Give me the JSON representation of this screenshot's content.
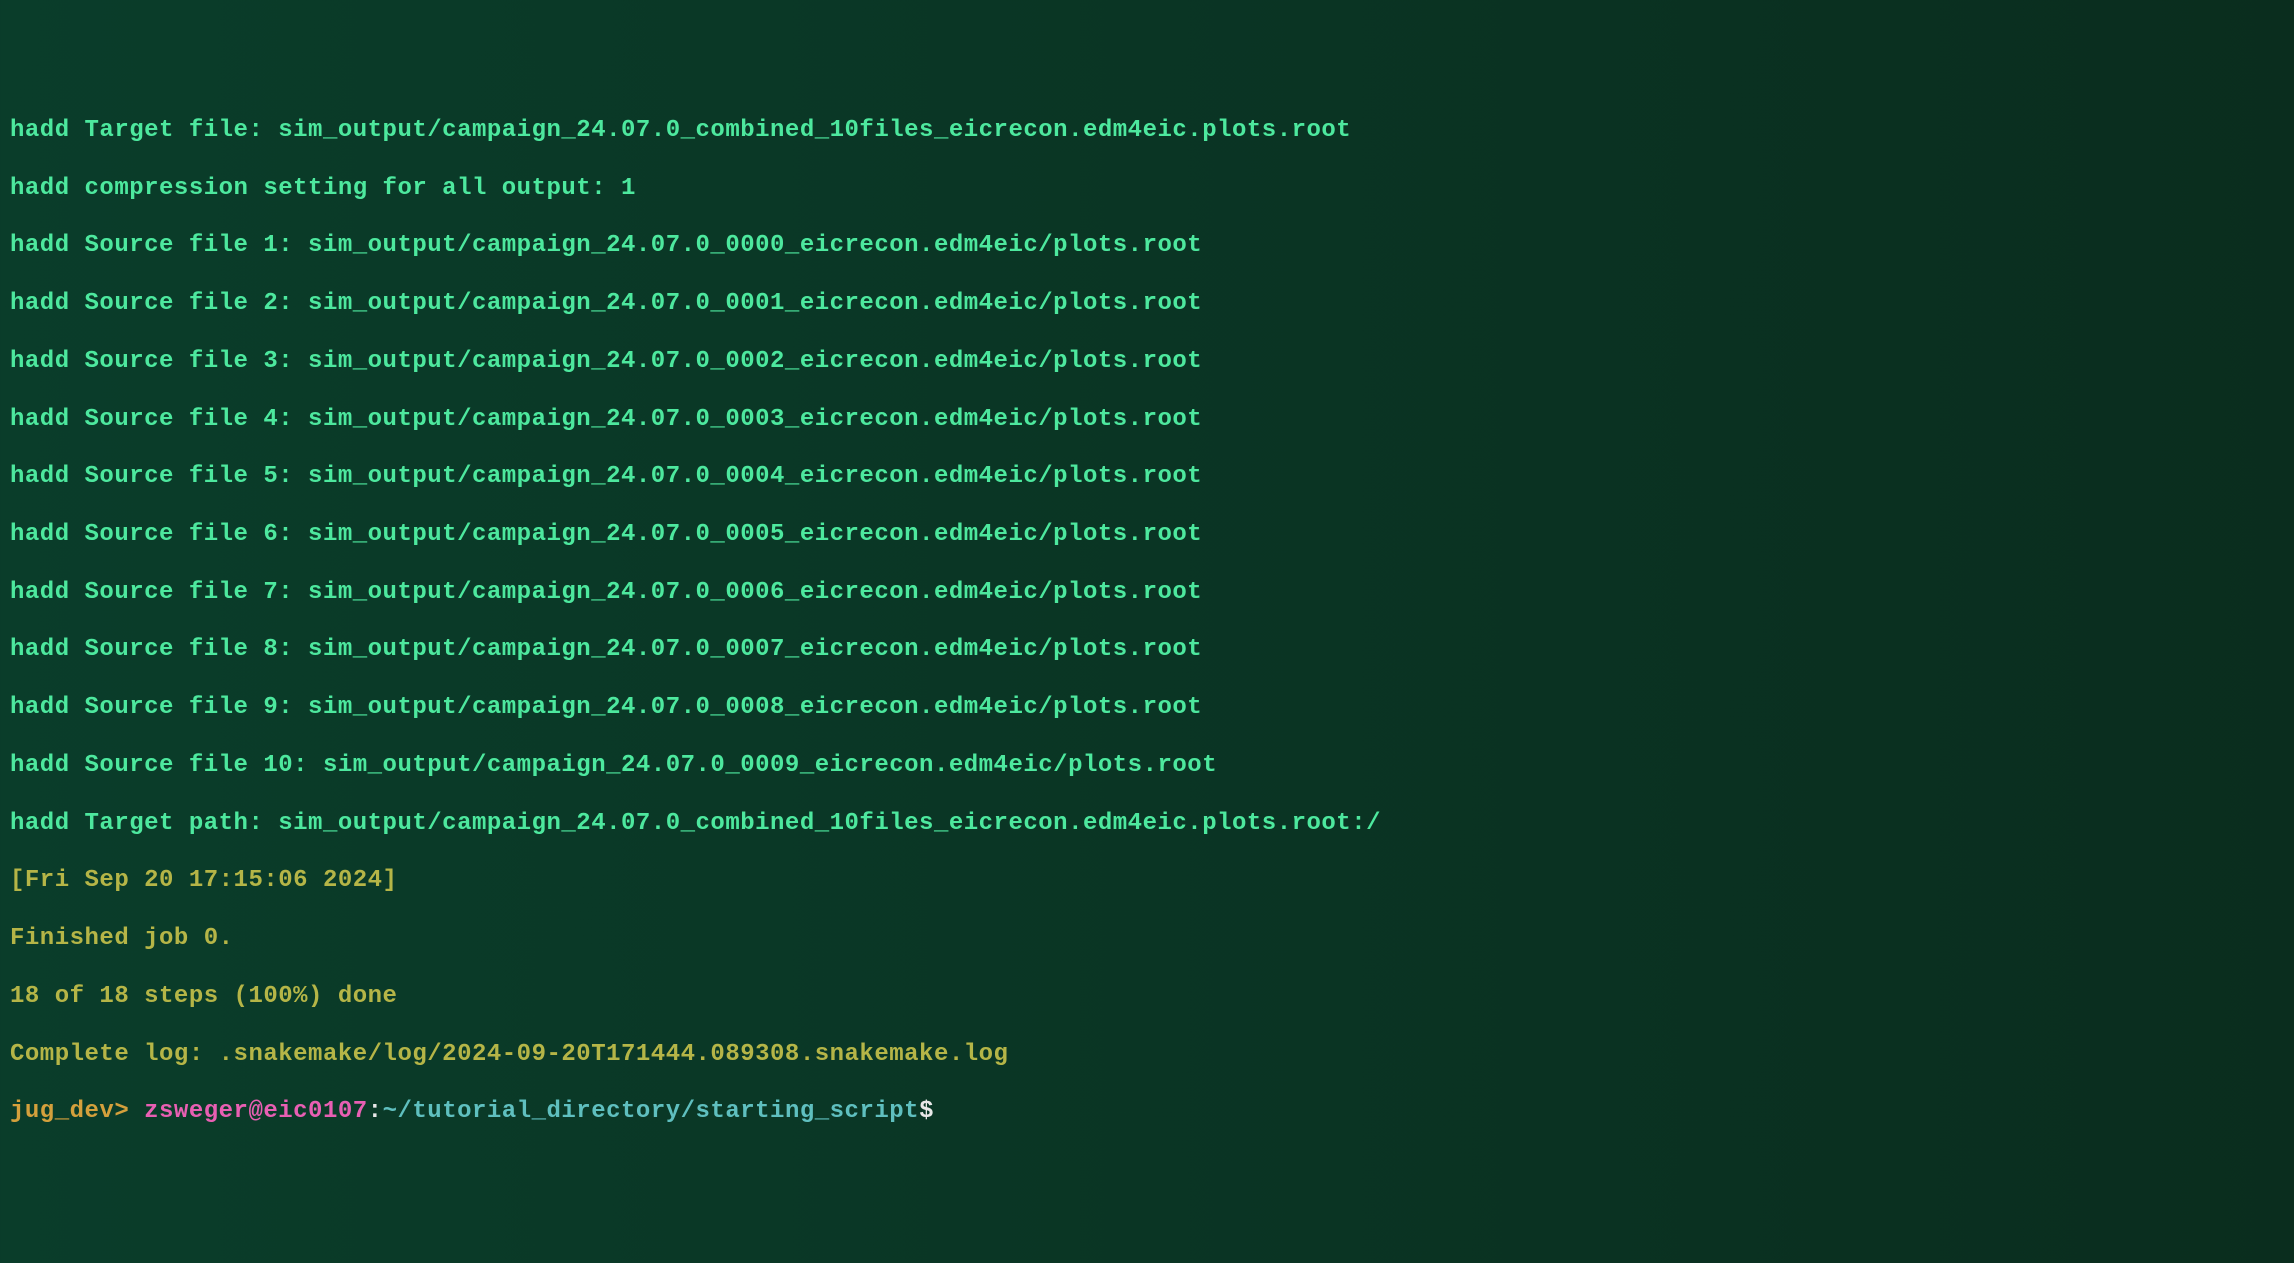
{
  "lines": {
    "target_file": "hadd Target file: sim_output/campaign_24.07.0_combined_10files_eicrecon.edm4eic.plots.root",
    "compression": "hadd compression setting for all output: 1",
    "source_1": "hadd Source file 1: sim_output/campaign_24.07.0_0000_eicrecon.edm4eic/plots.root",
    "source_2": "hadd Source file 2: sim_output/campaign_24.07.0_0001_eicrecon.edm4eic/plots.root",
    "source_3": "hadd Source file 3: sim_output/campaign_24.07.0_0002_eicrecon.edm4eic/plots.root",
    "source_4": "hadd Source file 4: sim_output/campaign_24.07.0_0003_eicrecon.edm4eic/plots.root",
    "source_5": "hadd Source file 5: sim_output/campaign_24.07.0_0004_eicrecon.edm4eic/plots.root",
    "source_6": "hadd Source file 6: sim_output/campaign_24.07.0_0005_eicrecon.edm4eic/plots.root",
    "source_7": "hadd Source file 7: sim_output/campaign_24.07.0_0006_eicrecon.edm4eic/plots.root",
    "source_8": "hadd Source file 8: sim_output/campaign_24.07.0_0007_eicrecon.edm4eic/plots.root",
    "source_9": "hadd Source file 9: sim_output/campaign_24.07.0_0008_eicrecon.edm4eic/plots.root",
    "source_10": "hadd Source file 10: sim_output/campaign_24.07.0_0009_eicrecon.edm4eic/plots.root",
    "target_path": "hadd Target path: sim_output/campaign_24.07.0_combined_10files_eicrecon.edm4eic.plots.root:/",
    "timestamp": "[Fri Sep 20 17:15:06 2024]",
    "finished": "Finished job 0.",
    "steps": "18 of 18 steps (100%) done",
    "complete_log": "Complete log: .snakemake/log/2024-09-20T171444.089308.snakemake.log"
  },
  "prompt": {
    "prefix": "jug_dev> ",
    "user_host": "zsweger@eic0107",
    "colon": ":",
    "path": "~/tutorial_directory/starting_script",
    "dollar": "$"
  }
}
